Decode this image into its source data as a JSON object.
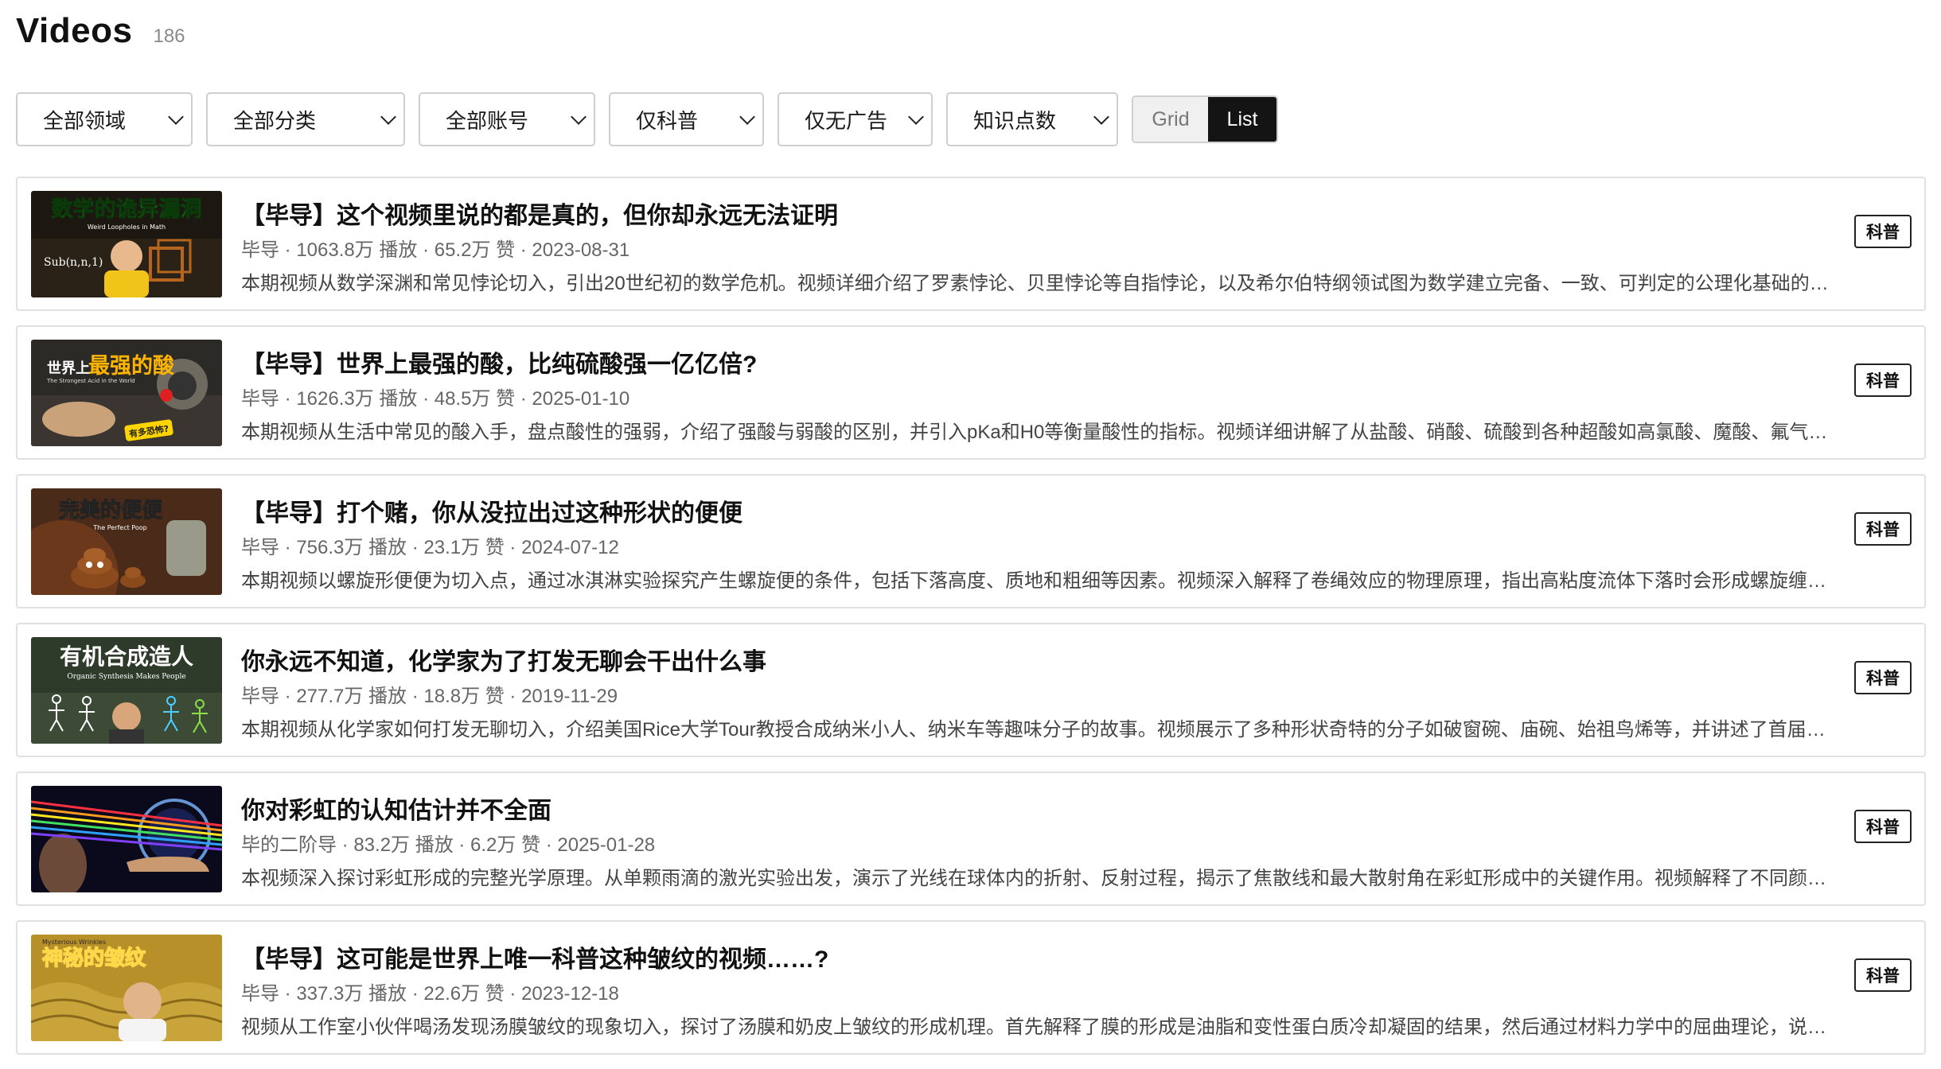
{
  "page": {
    "title": "Videos",
    "count": "186"
  },
  "filters": [
    {
      "label": "全部领域"
    },
    {
      "label": "全部分类"
    },
    {
      "label": "全部账号"
    },
    {
      "label": "仅科普"
    },
    {
      "label": "仅无广告"
    },
    {
      "label": "知识点数"
    }
  ],
  "view_toggle": {
    "grid_label": "Grid",
    "list_label": "List",
    "selected": "List"
  },
  "videos": [
    {
      "title": "【毕导】这个视频里说的都是真的，但你却永远无法证明",
      "meta": "毕导 · 1063.8万 播放 · 65.2万 赞 · 2023-08-31",
      "desc": "本期视频从数学深渊和常见悖论切入，引出20世纪初的数学危机。视频详细介绍了罗素悖论、贝里悖论等自指悖论，以及希尔伯特纲领试图为数学建立完备、一致、可判定的公理化基础的…",
      "badge": "科普",
      "thumb": {
        "headline": "数学的诡异漏洞",
        "sub": "Weird Loopholes in Math",
        "formula": "Sub(n,n,1)"
      }
    },
    {
      "title": "【毕导】世界上最强的酸，比纯硫酸强一亿亿倍?",
      "meta": "毕导 · 1626.3万 播放 · 48.5万 赞 · 2025-01-10",
      "desc": "本期视频从生活中常见的酸入手，盘点酸性的强弱，介绍了强酸与弱酸的区别，并引入pKa和H0等衡量酸性的指标。视频详细讲解了从盐酸、硝酸、硫酸到各种超酸如高氯酸、魔酸、氟气…",
      "badge": "科普",
      "thumb": {
        "headline_a": "世界上",
        "headline_b": "最强的酸",
        "sub": "The Strongest Acid in the World",
        "tag": "有多恐怖?"
      }
    },
    {
      "title": "【毕导】打个赌，你从没拉出过这种形状的便便",
      "meta": "毕导 · 756.3万 播放 · 23.1万 赞 · 2024-07-12",
      "desc": "本期视频以螺旋形便便为切入点，通过冰淇淋实验探究产生螺旋便的条件，包括下落高度、质地和粗细等因素。视频深入解释了卷绳效应的物理原理，指出高粘度流体下落时会形成螺旋缠…",
      "badge": "科普",
      "thumb": {
        "headline": "完美的便便",
        "sub": "The Perfect Poop"
      }
    },
    {
      "title": "你永远不知道，化学家为了打发无聊会干出什么事",
      "meta": "毕导 · 277.7万 播放 · 18.8万 赞 · 2019-11-29",
      "desc": "本期视频从化学家如何打发无聊切入，介绍美国Rice大学Tour教授合成纳米小人、纳米车等趣味分子的故事。视频展示了多种形状奇特的分子如破窗碗、庙碗、始祖鸟烯等，并讲述了首届…",
      "badge": "科普",
      "thumb": {
        "headline": "有机合成造人",
        "sub": "Organic Synthesis Makes People"
      }
    },
    {
      "title": "你对彩虹的认知估计并不全面",
      "meta": "毕的二阶导 · 83.2万 播放 · 6.2万 赞 · 2025-01-28",
      "desc": "本视频深入探讨彩虹形成的完整光学原理。从单颗雨滴的激光实验出发，演示了光线在球体内的折射、反射过程，揭示了焦散线和最大散射角在彩虹形成中的关键作用。视频解释了不同颜…",
      "badge": "科普",
      "thumb": {}
    },
    {
      "title": "【毕导】这可能是世界上唯一科普这种皱纹的视频……?",
      "meta": "毕导 · 337.3万 播放 · 22.6万 赞 · 2023-12-18",
      "desc": "视频从工作室小伙伴喝汤发现汤膜皱纹的现象切入，探讨了汤膜和奶皮上皱纹的形成机理。首先解释了膜的形成是油脂和变性蛋白质冷却凝固的结果，然后通过材料力学中的屈曲理论，说…",
      "badge": "科普",
      "thumb": {
        "headline": "神秘的皱纹",
        "sub": "Mysterious Wrinkles"
      }
    }
  ],
  "colors": {
    "accent_dark": "#141414",
    "border": "#e1e1e1",
    "meta_text": "#666666"
  }
}
